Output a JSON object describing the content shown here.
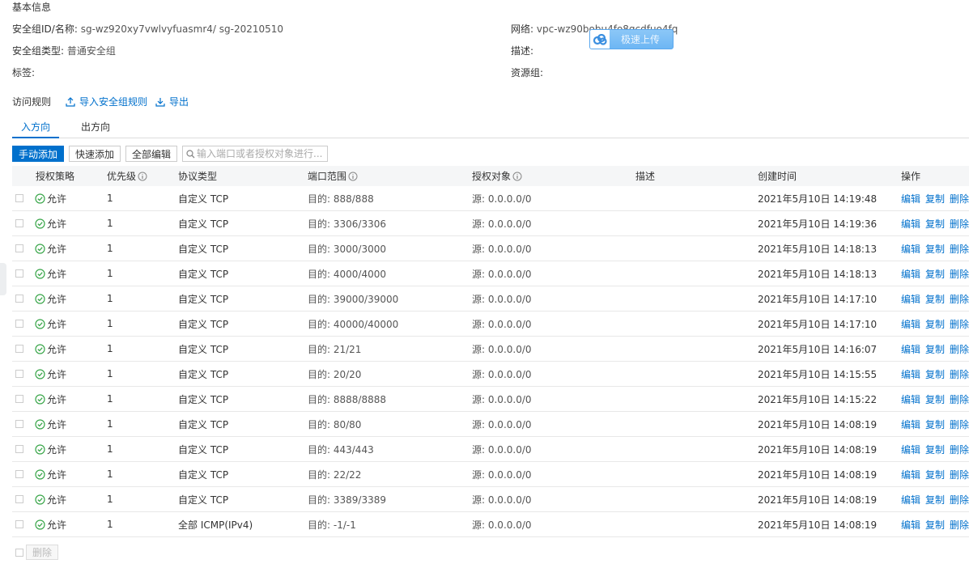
{
  "basic": {
    "title": "基本信息",
    "id_label": "安全组ID/名称:",
    "id_value": "sg-wz920xy7vwlvyfuasmr4/ sg-20210510",
    "type_label": "安全组类型:",
    "type_value": "普通安全组",
    "tags_label": "标签:",
    "network_label": "网络:",
    "network_value": "vpc-wz90bobu4fo8qcdfuo4fq",
    "desc_label": "描述:",
    "rg_label": "资源组:"
  },
  "upload_badge": {
    "text": "极速上传",
    "icon": "cloud-icon"
  },
  "rules": {
    "title": "访问规则",
    "import_label": "导入安全组规则",
    "export_label": "导出"
  },
  "tabs": [
    {
      "label": "入方向",
      "active": true
    },
    {
      "label": "出方向",
      "active": false
    }
  ],
  "toolbar": {
    "manual_add": "手动添加",
    "quick_add": "快速添加",
    "edit_all": "全部编辑",
    "search_placeholder": "输入端口或者授权对象进行..."
  },
  "columns": {
    "action": "授权策略",
    "priority": "优先级",
    "protocol": "协议类型",
    "port": "端口范围",
    "object": "授权对象",
    "desc": "描述",
    "created": "创建时间",
    "ops": "操作"
  },
  "op_labels": {
    "edit": "编辑",
    "copy": "复制",
    "delete": "删除"
  },
  "rows": [
    {
      "action": "允许",
      "priority": "1",
      "protocol": "自定义 TCP",
      "port": "目的: 888/888",
      "object": "源: 0.0.0.0/0",
      "created": "2021年5月10日 14:19:48"
    },
    {
      "action": "允许",
      "priority": "1",
      "protocol": "自定义 TCP",
      "port": "目的: 3306/3306",
      "object": "源: 0.0.0.0/0",
      "created": "2021年5月10日 14:19:36"
    },
    {
      "action": "允许",
      "priority": "1",
      "protocol": "自定义 TCP",
      "port": "目的: 3000/3000",
      "object": "源: 0.0.0.0/0",
      "created": "2021年5月10日 14:18:13"
    },
    {
      "action": "允许",
      "priority": "1",
      "protocol": "自定义 TCP",
      "port": "目的: 4000/4000",
      "object": "源: 0.0.0.0/0",
      "created": "2021年5月10日 14:18:13"
    },
    {
      "action": "允许",
      "priority": "1",
      "protocol": "自定义 TCP",
      "port": "目的: 39000/39000",
      "object": "源: 0.0.0.0/0",
      "created": "2021年5月10日 14:17:10"
    },
    {
      "action": "允许",
      "priority": "1",
      "protocol": "自定义 TCP",
      "port": "目的: 40000/40000",
      "object": "源: 0.0.0.0/0",
      "created": "2021年5月10日 14:17:10"
    },
    {
      "action": "允许",
      "priority": "1",
      "protocol": "自定义 TCP",
      "port": "目的: 21/21",
      "object": "源: 0.0.0.0/0",
      "created": "2021年5月10日 14:16:07"
    },
    {
      "action": "允许",
      "priority": "1",
      "protocol": "自定义 TCP",
      "port": "目的: 20/20",
      "object": "源: 0.0.0.0/0",
      "created": "2021年5月10日 14:15:55"
    },
    {
      "action": "允许",
      "priority": "1",
      "protocol": "自定义 TCP",
      "port": "目的: 8888/8888",
      "object": "源: 0.0.0.0/0",
      "created": "2021年5月10日 14:15:22"
    },
    {
      "action": "允许",
      "priority": "1",
      "protocol": "自定义 TCP",
      "port": "目的: 80/80",
      "object": "源: 0.0.0.0/0",
      "created": "2021年5月10日 14:08:19"
    },
    {
      "action": "允许",
      "priority": "1",
      "protocol": "自定义 TCP",
      "port": "目的: 443/443",
      "object": "源: 0.0.0.0/0",
      "created": "2021年5月10日 14:08:19"
    },
    {
      "action": "允许",
      "priority": "1",
      "protocol": "自定义 TCP",
      "port": "目的: 22/22",
      "object": "源: 0.0.0.0/0",
      "created": "2021年5月10日 14:08:19"
    },
    {
      "action": "允许",
      "priority": "1",
      "protocol": "自定义 TCP",
      "port": "目的: 3389/3389",
      "object": "源: 0.0.0.0/0",
      "created": "2021年5月10日 14:08:19"
    },
    {
      "action": "允许",
      "priority": "1",
      "protocol": "全部 ICMP(IPv4)",
      "port": "目的: -1/-1",
      "object": "源: 0.0.0.0/0",
      "created": "2021年5月10日 14:08:19"
    }
  ],
  "footer": {
    "delete_label": "删除"
  },
  "colors": {
    "accent": "#0070cc",
    "allow_green": "#3aa64a"
  }
}
